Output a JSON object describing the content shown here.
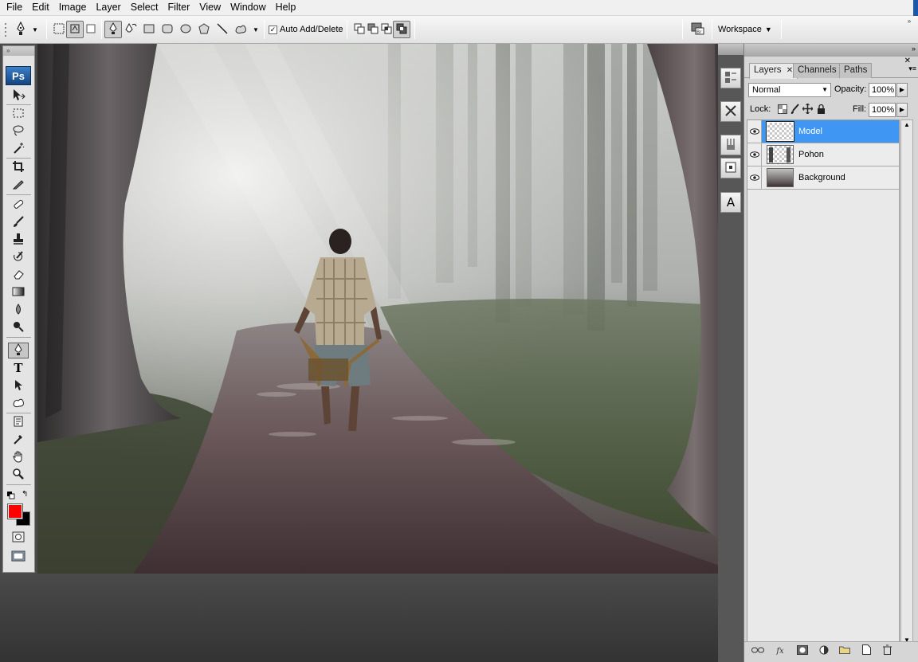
{
  "menu": [
    "File",
    "Edit",
    "Image",
    "Layer",
    "Select",
    "Filter",
    "View",
    "Window",
    "Help"
  ],
  "options_bar": {
    "auto_add_delete_label": "Auto Add/Delete",
    "auto_add_delete_checked": true,
    "workspace_label": "Workspace"
  },
  "toolbox": {
    "logo_text": "Ps",
    "foreground_color": "#ff0000",
    "background_color": "#000000"
  },
  "layers_panel": {
    "tabs": [
      "Layers",
      "Channels",
      "Paths"
    ],
    "active_tab": "Layers",
    "blend_mode": "Normal",
    "opacity_label": "Opacity:",
    "opacity_value": "100%",
    "lock_label": "Lock:",
    "fill_label": "Fill:",
    "fill_value": "100%",
    "layers": [
      {
        "name": "Model",
        "selected": true,
        "visible": true
      },
      {
        "name": "Pohon",
        "selected": false,
        "visible": true
      },
      {
        "name": "Background",
        "selected": false,
        "visible": true
      }
    ]
  },
  "dock": {
    "character_panel_glyph": "A"
  },
  "colors": {
    "selection_blue": "#3f97f3",
    "ps_blue": "#1f5ea3"
  }
}
